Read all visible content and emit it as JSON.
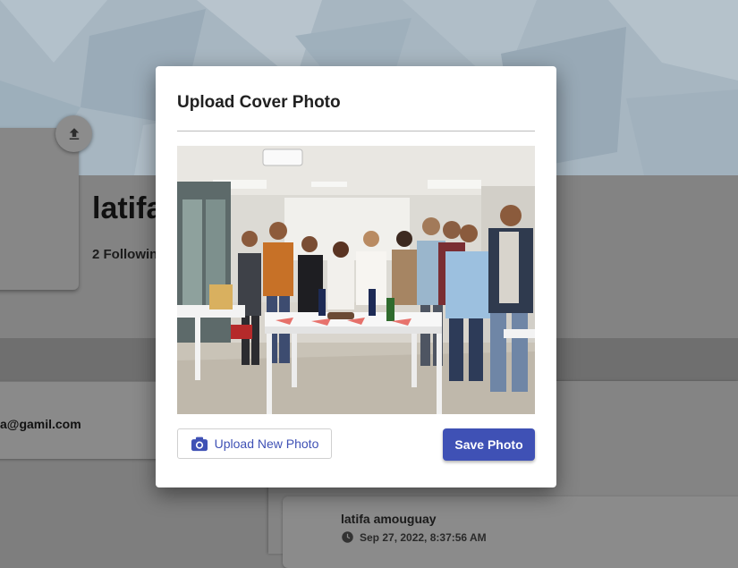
{
  "profile": {
    "name": "latifa",
    "following_label": "2 Followin",
    "email_fragment": "a@gamil.com"
  },
  "post": {
    "author": "latifa amouguay",
    "timestamp": "Sep 27, 2022, 8:37:56 AM"
  },
  "modal": {
    "title": "Upload Cover Photo",
    "upload_button_label": "Upload New Photo",
    "save_button_label": "Save Photo"
  },
  "colors": {
    "primary": "#3f51b5",
    "overlay_dim": "#7e7e7e",
    "cover_tint": "#a9b7c2"
  },
  "icons": {
    "cover_upload": "upload-icon",
    "upload_button": "camera-icon",
    "post_time": "clock-icon"
  }
}
